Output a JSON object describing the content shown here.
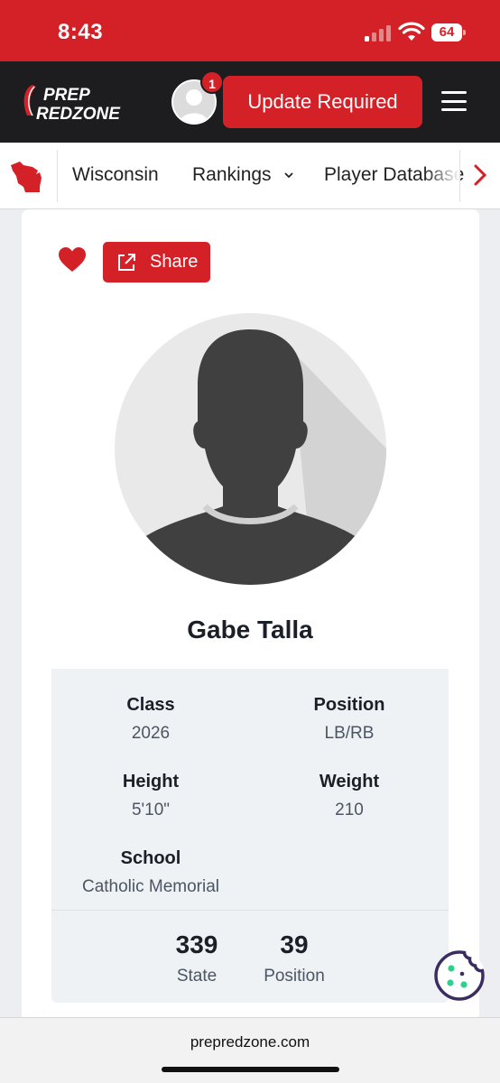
{
  "status_bar": {
    "time": "8:43",
    "battery": "64"
  },
  "header": {
    "logo_line1": "PREP",
    "logo_line2": "REDZONE",
    "notification_count": "1",
    "update_button": "Update Required"
  },
  "nav": {
    "items": [
      "Wisconsin",
      "Rankings",
      "Player Database"
    ]
  },
  "actions": {
    "share_label": "Share"
  },
  "player": {
    "name": "Gabe Talla",
    "class_label": "Class",
    "class_value": "2026",
    "position_label": "Position",
    "position_value": "LB/RB",
    "height_label": "Height",
    "height_value": "5'10\"",
    "weight_label": "Weight",
    "weight_value": "210",
    "school_label": "School",
    "school_value": "Catholic Memorial"
  },
  "rankings": {
    "state_rank": "339",
    "state_label": "State",
    "position_rank": "39",
    "position_label": "Position"
  },
  "browser": {
    "url": "prepredzone.com"
  },
  "colors": {
    "brand_red": "#d42128",
    "header_dark": "#1d1d1f",
    "info_bg": "#eff2f5",
    "cookie_purple": "#3b2c63",
    "cookie_green": "#2fcf8e"
  }
}
